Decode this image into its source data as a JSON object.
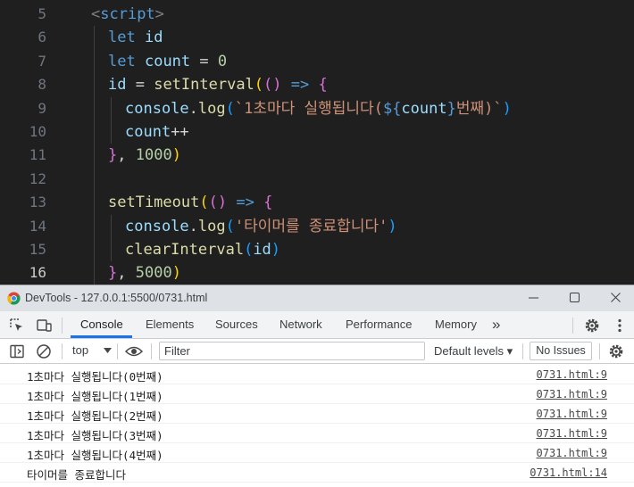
{
  "editor": {
    "lines": [
      {
        "no": "5",
        "indent": 0,
        "tokens": [
          [
            "t-tag",
            "<"
          ],
          [
            "t-tagname",
            "script"
          ],
          [
            "t-tag",
            ">"
          ]
        ]
      },
      {
        "no": "6",
        "indent": 1,
        "tokens": [
          [
            "t-kw",
            "let"
          ],
          [
            "t-op",
            " "
          ],
          [
            "t-var",
            "id"
          ]
        ]
      },
      {
        "no": "7",
        "indent": 1,
        "tokens": [
          [
            "t-kw",
            "let"
          ],
          [
            "t-op",
            " "
          ],
          [
            "t-var",
            "count"
          ],
          [
            "t-op",
            " = "
          ],
          [
            "t-num",
            "0"
          ]
        ]
      },
      {
        "no": "8",
        "indent": 1,
        "tokens": [
          [
            "t-var",
            "id"
          ],
          [
            "t-op",
            " = "
          ],
          [
            "t-fn",
            "setInterval"
          ],
          [
            "t-b1",
            "("
          ],
          [
            "t-b2",
            "()"
          ],
          [
            "t-op",
            " "
          ],
          [
            "t-kw",
            "=>"
          ],
          [
            "t-op",
            " "
          ],
          [
            "t-b2",
            "{"
          ]
        ]
      },
      {
        "no": "9",
        "indent": 2,
        "tokens": [
          [
            "t-var",
            "console"
          ],
          [
            "t-op",
            "."
          ],
          [
            "t-fn",
            "log"
          ],
          [
            "t-b3",
            "("
          ],
          [
            "t-str",
            "`1초마다 실행됩니다("
          ],
          [
            "t-tpl",
            "${"
          ],
          [
            "t-var",
            "count"
          ],
          [
            "t-tpl",
            "}"
          ],
          [
            "t-str",
            "번째)`"
          ],
          [
            "t-b3",
            ")"
          ]
        ]
      },
      {
        "no": "10",
        "indent": 2,
        "tokens": [
          [
            "t-var",
            "count"
          ],
          [
            "t-op",
            "++"
          ]
        ]
      },
      {
        "no": "11",
        "indent": 1,
        "tokens": [
          [
            "t-b2",
            "}"
          ],
          [
            "t-op",
            ", "
          ],
          [
            "t-num",
            "1000"
          ],
          [
            "t-b1",
            ")"
          ]
        ]
      },
      {
        "no": "12",
        "indent": 1,
        "tokens": []
      },
      {
        "no": "13",
        "indent": 1,
        "tokens": [
          [
            "t-fn",
            "setTimeout"
          ],
          [
            "t-b1",
            "("
          ],
          [
            "t-b2",
            "()"
          ],
          [
            "t-op",
            " "
          ],
          [
            "t-kw",
            "=>"
          ],
          [
            "t-op",
            " "
          ],
          [
            "t-b2",
            "{"
          ]
        ]
      },
      {
        "no": "14",
        "indent": 2,
        "tokens": [
          [
            "t-var",
            "console"
          ],
          [
            "t-op",
            "."
          ],
          [
            "t-fn",
            "log"
          ],
          [
            "t-b3",
            "("
          ],
          [
            "t-str",
            "'타이머를 종료합니다'"
          ],
          [
            "t-b3",
            ")"
          ]
        ]
      },
      {
        "no": "15",
        "indent": 2,
        "tokens": [
          [
            "t-fn",
            "clearInterval"
          ],
          [
            "t-b3",
            "("
          ],
          [
            "t-var",
            "id"
          ],
          [
            "t-b3",
            ")"
          ]
        ]
      },
      {
        "no": "16",
        "indent": 1,
        "active": true,
        "tokens": [
          [
            "t-b2",
            "}"
          ],
          [
            "t-op",
            ", "
          ],
          [
            "t-num",
            "5000"
          ],
          [
            "t-b1",
            ")"
          ]
        ]
      }
    ]
  },
  "devtools": {
    "window_title": "DevTools - 127.0.0.1:5500/0731.html",
    "tabs": [
      "Console",
      "Elements",
      "Sources",
      "Network",
      "Performance",
      "Memory"
    ],
    "more_tabs": "»",
    "context": "top",
    "filter_placeholder": "Filter",
    "levels": "Default levels ▾",
    "issues": "No Issues",
    "logs": [
      {
        "msg": "1초마다 실행됩니다(0번째)",
        "src": "0731.html:9"
      },
      {
        "msg": "1초마다 실행됩니다(1번째)",
        "src": "0731.html:9"
      },
      {
        "msg": "1초마다 실행됩니다(2번째)",
        "src": "0731.html:9"
      },
      {
        "msg": "1초마다 실행됩니다(3번째)",
        "src": "0731.html:9"
      },
      {
        "msg": "1초마다 실행됩니다(4번째)",
        "src": "0731.html:9"
      },
      {
        "msg": "타이머를 종료합니다",
        "src": "0731.html:14"
      }
    ]
  }
}
